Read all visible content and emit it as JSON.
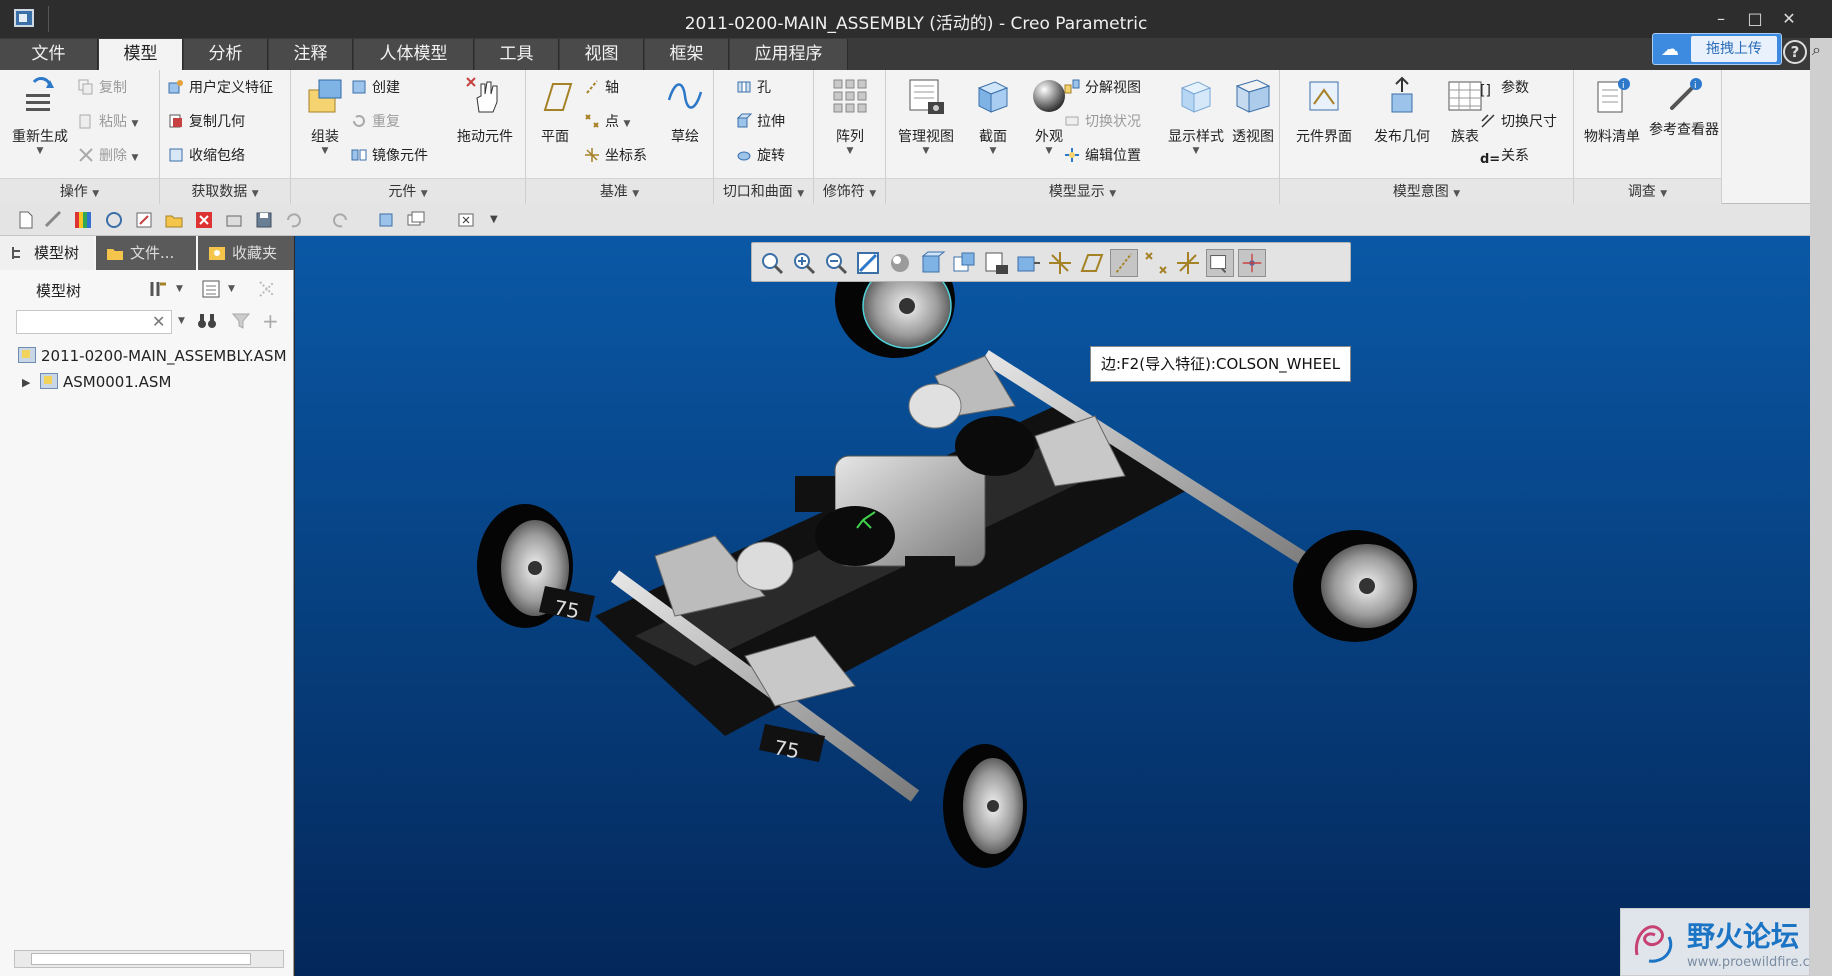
{
  "window": {
    "title": "2011-0200-MAIN_ASSEMBLY (活动的) - Creo Parametric",
    "minimize": "–",
    "maximize": "□",
    "close": "✕"
  },
  "menu": {
    "tabs": [
      "文件",
      "模型",
      "分析",
      "注释",
      "人体模型",
      "工具",
      "视图",
      "框架",
      "应用程序"
    ],
    "active": "模型"
  },
  "baidu": {
    "label": "拖拽上传"
  },
  "help": "?",
  "ribbon": {
    "ops": {
      "label": "操作",
      "regenerate": "重新生成",
      "copy": "复制",
      "paste": "粘贴",
      "delete": "删除"
    },
    "getdata": {
      "label": "获取数据",
      "udf": "用户定义特征",
      "copy_geom": "复制几何",
      "shrinkwrap": "收缩包络"
    },
    "component": {
      "label": "元件",
      "assemble": "组装",
      "create": "创建",
      "repeat": "重复",
      "mirror": "镜像元件",
      "drag": "拖动元件"
    },
    "datum": {
      "label": "基准",
      "plane": "平面",
      "axis": "轴",
      "point": "点",
      "csys": "坐标系",
      "sketch": "草绘"
    },
    "cut": {
      "label": "切口和曲面",
      "hole": "孔",
      "extrude": "拉伸",
      "revolve": "旋转"
    },
    "modifier": {
      "label": "修饰符",
      "pattern": "阵列"
    },
    "display": {
      "label": "模型显示",
      "manage_views": "管理视图",
      "section": "截面",
      "appearance": "外观",
      "explode": "分解视图",
      "toggle_state": "切换状况",
      "edit_pos": "编辑位置",
      "display_style": "显示样式",
      "perspective": "透视图"
    },
    "intent": {
      "label": "模型意图",
      "comp_interface": "元件界面",
      "publish_geom": "发布几何",
      "family_table": "族表",
      "parameters": "参数",
      "switch_dims": "切换尺寸",
      "relations": "关系"
    },
    "investigate": {
      "label": "调查",
      "bom": "物料清单",
      "ref_viewer": "参考查看器"
    }
  },
  "panel": {
    "tabs": [
      "模型树",
      "文件...",
      "收藏夹"
    ],
    "tree_title": "模型树",
    "search_placeholder": "",
    "nodes": [
      "2011-0200-MAIN_ASSEMBLY.ASM",
      "ASM0001.ASM"
    ]
  },
  "viewport": {
    "tooltip": "边:F2(导入特征):COLSON_WHEEL",
    "wheel_number": "75"
  },
  "watermark": {
    "title": "野火论坛",
    "url": "www.proewildfire.cn"
  },
  "colors": {
    "titlebar": "#2d2d2d",
    "ribbon": "#f3f3f3",
    "viewport_top": "#0a58a6",
    "viewport_bottom": "#04275a",
    "accent": "#3d8be0"
  }
}
